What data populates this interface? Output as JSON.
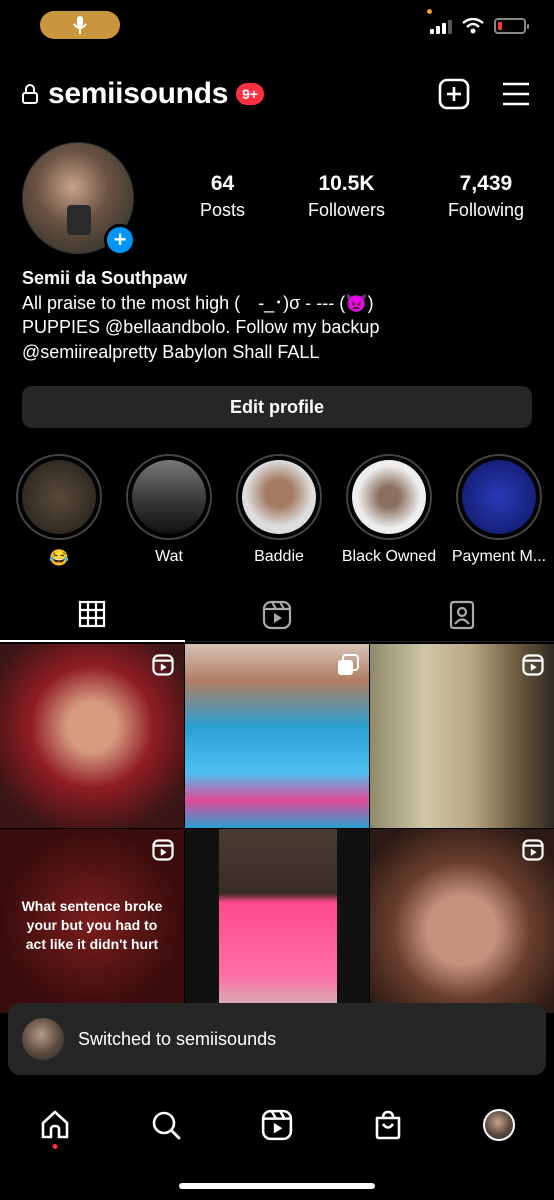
{
  "header": {
    "username": "semiisounds",
    "notification_badge": "9+"
  },
  "profile": {
    "stats": [
      {
        "value": "64",
        "label": "Posts"
      },
      {
        "value": "10.5K",
        "label": "Followers"
      },
      {
        "value": "7,439",
        "label": "Following"
      }
    ],
    "bio": {
      "name": "Semii da Southpaw",
      "lines": [
        "All praise to the most high (　-_･)σ - --- (👿)",
        "PUPPIES @bellaandbolo. Follow my backup",
        "@semiirealpretty Babylon Shall FALL"
      ]
    },
    "edit_button": "Edit profile"
  },
  "highlights": [
    {
      "label": "😂",
      "color": "#3a3a30"
    },
    {
      "label": "Wat",
      "color": "#444444"
    },
    {
      "label": "Baddie",
      "color": "#8a6a5a"
    },
    {
      "label": "Black Owned",
      "color": "#6a5a50"
    },
    {
      "label": "Payment M...",
      "color": "#1a2a8a"
    }
  ],
  "grid": {
    "post_4_text": "What sentence broke your but you had to act like it didn't hurt"
  },
  "toast": {
    "text": "Switched to semiisounds"
  },
  "colors": {
    "accent_blue": "#0095f6",
    "badge_red": "#ff3040",
    "button_bg": "#262626"
  }
}
